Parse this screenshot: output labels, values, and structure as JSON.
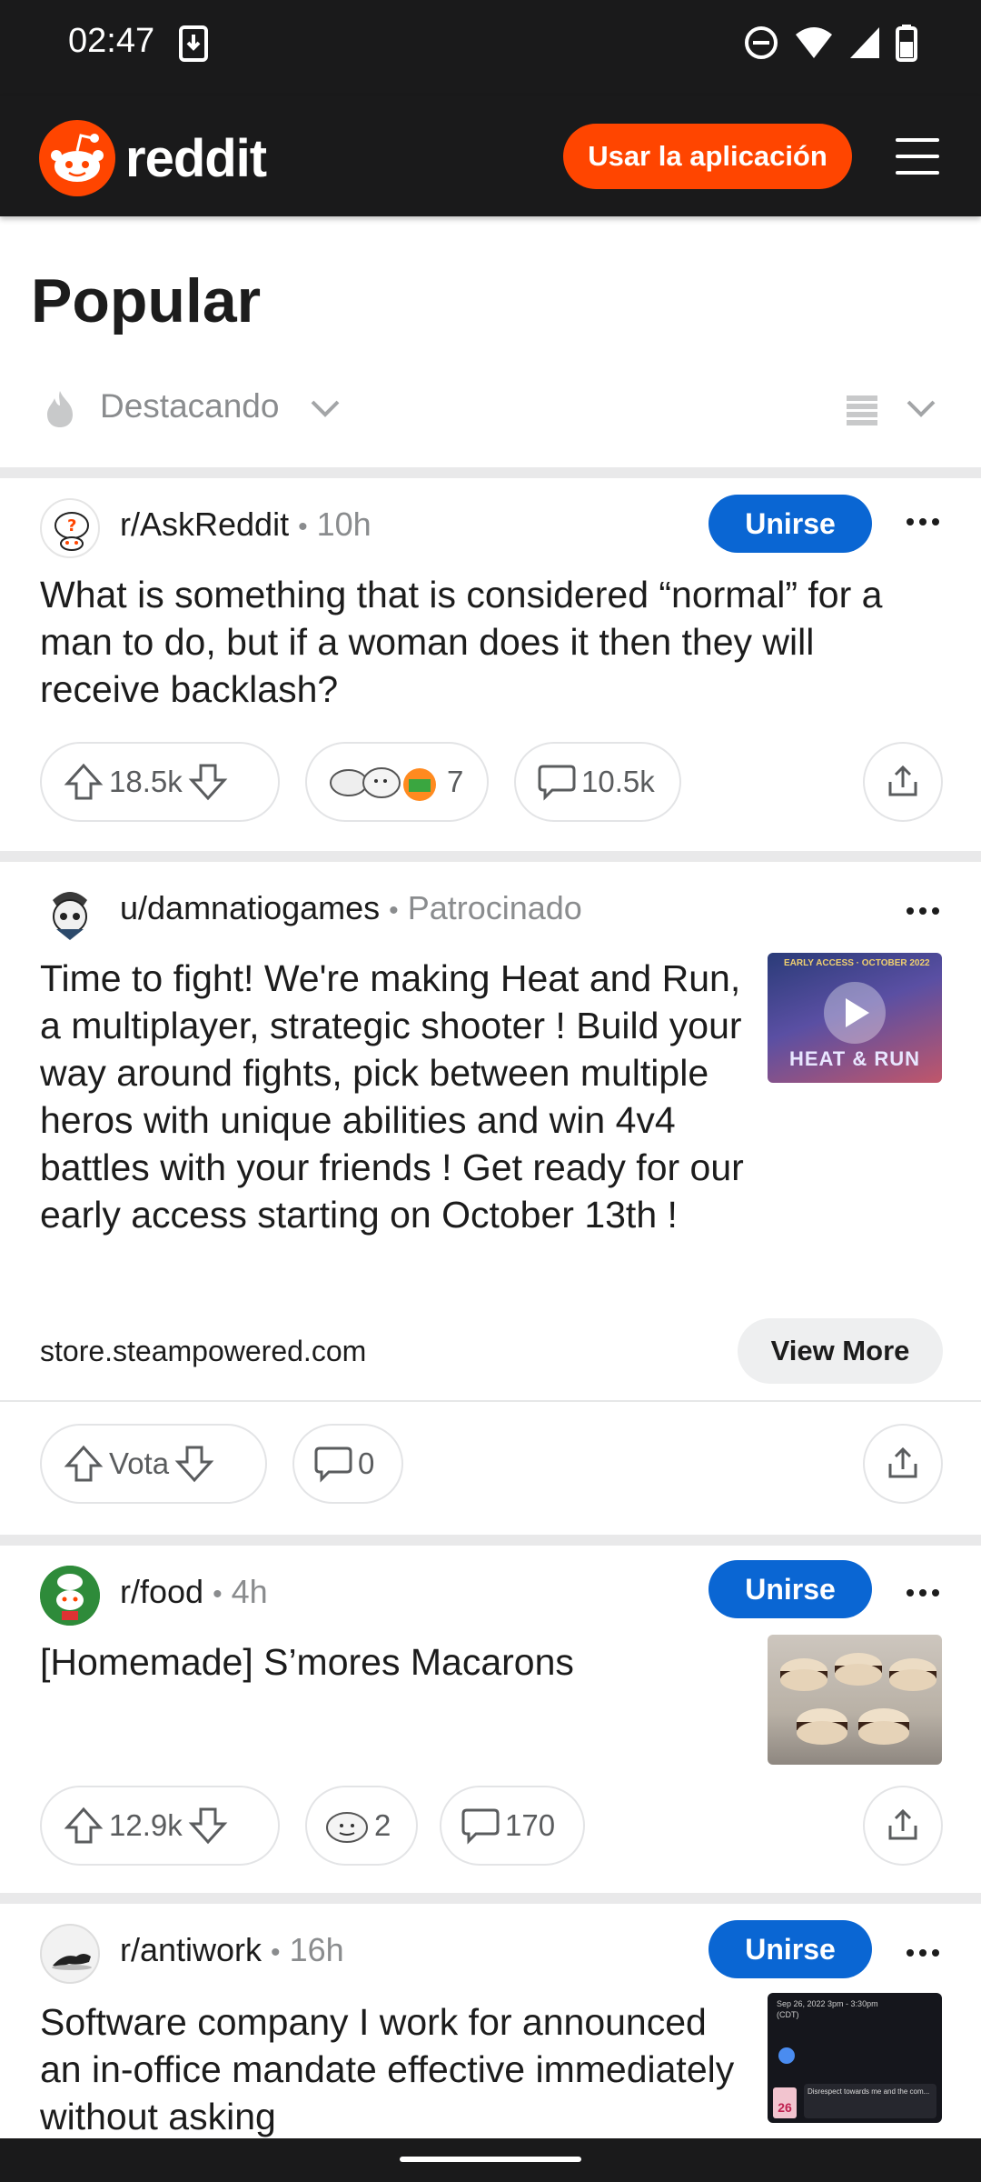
{
  "status_bar": {
    "time": "02:47",
    "icons": [
      "download-icon",
      "do-not-disturb-icon",
      "wifi-icon",
      "signal-icon",
      "battery-icon"
    ]
  },
  "header": {
    "logo_text": "reddit",
    "app_button": "Usar la aplicación",
    "menu_icon": "hamburger-menu-icon"
  },
  "page": {
    "title": "Popular",
    "sort_label": "Destacando"
  },
  "colors": {
    "brand": "#ff4500",
    "join": "#0a66d3",
    "dark_bar": "#1a1a1b",
    "muted_text": "#8a8c8e"
  },
  "posts": [
    {
      "subreddit": "r/AskReddit",
      "separator": "•",
      "age": "10h",
      "join_label": "Unirse",
      "title": "What is something that is considered “normal” for a man to do, but if a woman does it then they will receive backlash?",
      "votes": "18.5k",
      "awards_count": "7",
      "comments": "10.5k"
    },
    {
      "user": "u/damnatiogames",
      "separator": "•",
      "tag": "Patrocinado",
      "title": "Time to fight! We're making Heat and Run, a multiplayer, strategic shooter ! Build your way around fights, pick between multiple heros with unique abilities and win 4v4 battles with your friends ! Get ready for our early access starting on October 13th !",
      "thumb_caption": "EARLY ACCESS · OCTOBER 2022",
      "thumb_logo": "HEAT & RUN",
      "domain": "store.steampowered.com",
      "view_more": "View More",
      "vote_label": "Vota",
      "comments": "0"
    },
    {
      "subreddit": "r/food",
      "separator": "•",
      "age": "4h",
      "join_label": "Unirse",
      "title": "[Homemade] S’mores Macarons",
      "votes": "12.9k",
      "awards_count": "2",
      "comments": "170"
    },
    {
      "subreddit": "r/antiwork",
      "separator": "•",
      "age": "16h",
      "join_label": "Unirse",
      "title": "Software company I work for announced an in-office mandate effective immediately without asking",
      "thumb_line1": "Sep 26, 2022 3pm - 3:30pm (CDT)",
      "thumb_line2": "Disrespect towards me and the com...",
      "thumb_day": "26"
    }
  ]
}
